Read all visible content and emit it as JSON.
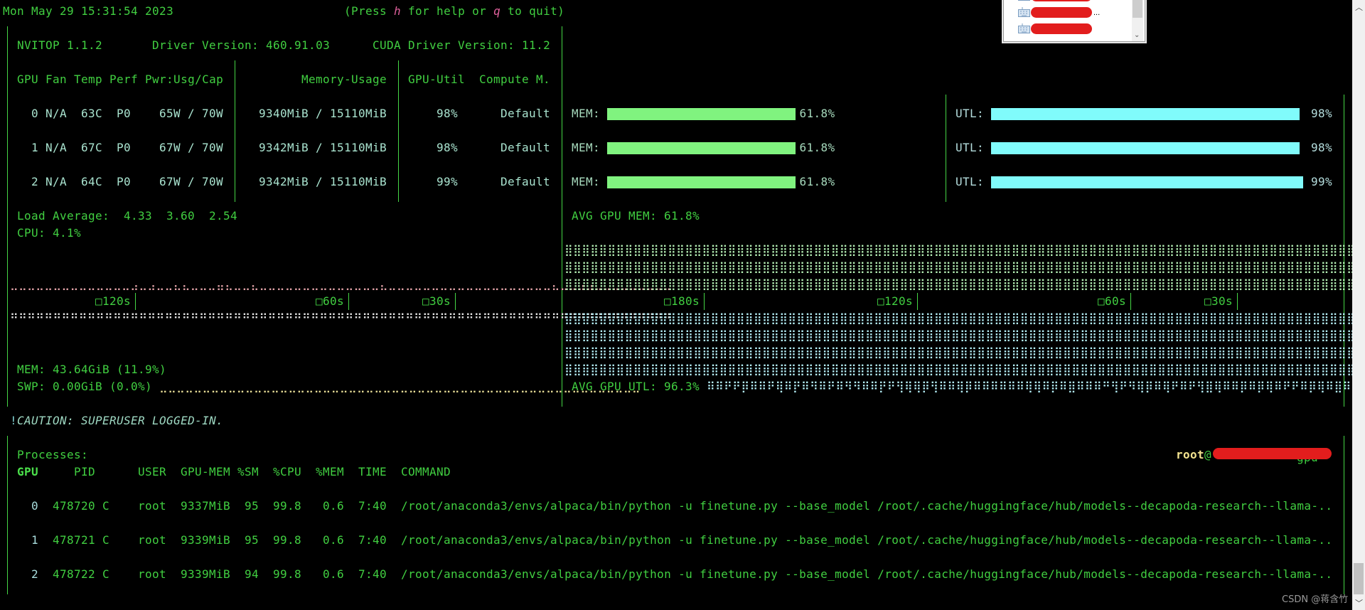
{
  "header": {
    "datetime": "Mon May 29 15:31:54 2023",
    "help_open": "(Press ",
    "help_key": "h",
    "help_middle": " for help or ",
    "quit_key": "q",
    "help_close": " to quit)"
  },
  "info": {
    "app_version": "NVITOP 1.1.2",
    "driver_version": "Driver Version: 460.91.03",
    "cuda_version": "CUDA Driver Version: 11.2"
  },
  "gpu_table": {
    "header_left": "GPU Fan Temp Perf Pwr:Usg/Cap",
    "header_memory": "Memory-Usage",
    "header_util": "GPU-Util",
    "header_compute": "Compute M.",
    "mem_label": "MEM:",
    "utl_label": "UTL:",
    "rows": [
      {
        "index": "0",
        "fan": "N/A",
        "temp": "63C",
        "perf": "P0",
        "power": "65W / 70W",
        "memory": "9340MiB / 15110MiB",
        "util": "98%",
        "compute_mode": "Default",
        "mem_percent_text": "61.8%",
        "mem_percent": 61.8,
        "utl_percent_text": "98%",
        "utl_percent": 98
      },
      {
        "index": "1",
        "fan": "N/A",
        "temp": "67C",
        "perf": "P0",
        "power": "67W / 70W",
        "memory": "9342MiB / 15110MiB",
        "util": "98%",
        "compute_mode": "Default",
        "mem_percent_text": "61.8%",
        "mem_percent": 61.8,
        "utl_percent_text": "98%",
        "utl_percent": 98
      },
      {
        "index": "2",
        "fan": "N/A",
        "temp": "64C",
        "perf": "P0",
        "power": "67W / 70W",
        "memory": "9342MiB / 15110MiB",
        "util": "99%",
        "compute_mode": "Default",
        "mem_percent_text": "61.8%",
        "mem_percent": 61.8,
        "utl_percent_text": "99%",
        "utl_percent": 99
      }
    ]
  },
  "host_panel": {
    "load_average_label": "Load Average:",
    "load_average": [
      "4.33",
      "3.60",
      "2.54"
    ],
    "cpu": "CPU: 4.1%",
    "cpu_percent": 4.1,
    "mem": "MEM: 43.64GiB (11.9%)",
    "mem_percent": 11.9,
    "swp": "SWP: 0.00GiB (0.0%)",
    "swp_percent": 0.0
  },
  "gpu_panel": {
    "avg_mem": "AVG GPU MEM: 61.8%",
    "avg_mem_percent": 61.8,
    "avg_util": "AVG GPU UTL: 96.3%",
    "avg_util_percent": 96.3
  },
  "time_axis": {
    "marker": "□",
    "host_ticks": [
      {
        "seconds": 120,
        "label": "120s"
      },
      {
        "seconds": 60,
        "label": "60s"
      },
      {
        "seconds": 30,
        "label": "30s"
      }
    ],
    "gpu_ticks": [
      {
        "seconds": 180,
        "label": "180s"
      },
      {
        "seconds": 120,
        "label": "120s"
      },
      {
        "seconds": 60,
        "label": "60s"
      },
      {
        "seconds": 30,
        "label": "30s"
      }
    ]
  },
  "caution": {
    "bang": "!",
    "text": "CAUTION: SUPERUSER LOGGED-IN."
  },
  "processes": {
    "title": "Processes:",
    "user": "root",
    "at": "@",
    "host_tail": "gpu",
    "columns": {
      "gpu": "GPU",
      "pid": "PID",
      "user": "USER",
      "gpu_mem": "GPU-MEM",
      "sm": "%SM",
      "cpu": "%CPU",
      "mem": "%MEM",
      "time": "TIME",
      "command": "COMMAND"
    },
    "rows": [
      {
        "gpu": "0",
        "pid": "478720",
        "type": "C",
        "user": "root",
        "gpu_mem": "9337MiB",
        "sm": "95",
        "cpu": "99.8",
        "mem": "0.6",
        "time": "7:40",
        "command": "/root/anaconda3/envs/alpaca/bin/python -u finetune.py --base_model /root/.cache/huggingface/hub/models--decapoda-research--llama-.."
      },
      {
        "gpu": "1",
        "pid": "478721",
        "type": "C",
        "user": "root",
        "gpu_mem": "9339MiB",
        "sm": "95",
        "cpu": "99.8",
        "mem": "0.6",
        "time": "7:40",
        "command": "/root/anaconda3/envs/alpaca/bin/python -u finetune.py --base_model /root/.cache/huggingface/hub/models--decapoda-research--llama-.."
      },
      {
        "gpu": "2",
        "pid": "478722",
        "type": "C",
        "user": "root",
        "gpu_mem": "9339MiB",
        "sm": "94",
        "cpu": "99.8",
        "mem": "0.6",
        "time": "7:40",
        "command": "/root/anaconda3/envs/alpaca/bin/python -u finetune.py --base_model /root/.cache/huggingface/hub/models--decapoda-research--llama-.."
      }
    ]
  },
  "overlay": {
    "popup_more": "...",
    "scroll_up": "︿",
    "scroll_down": "﹀",
    "popup_scroll_down": "⌄",
    "watermark": "CSDN @蒋含竹"
  },
  "colors": {
    "terminal_green": "#41cf41",
    "border_green": "#45d645",
    "gpu_row_text": "#a9e3cf",
    "mem_bar": "#80f37f",
    "utl_bar": "#80fbfb",
    "cpu_graph": "#e3a3a8",
    "host_mem_graph": "#e6e6e6",
    "swap_graph": "#e6dc96",
    "gpu_mem_graph": "#b4efb4",
    "gpu_util_graph": "#b4eef6",
    "key_highlight": "#e0609c",
    "user_highlight": "#f3e38f",
    "redaction": "#e21d1d"
  }
}
